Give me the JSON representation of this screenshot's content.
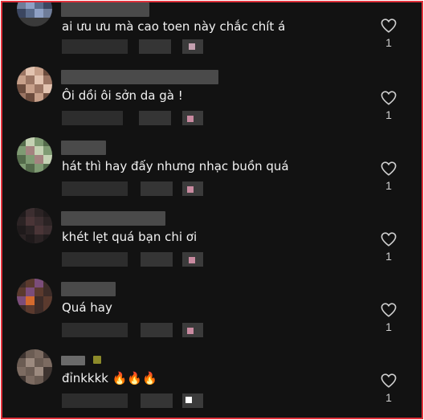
{
  "comments": [
    {
      "text": "ai ưu ưu mà cao toen này chắc chít á",
      "likes": "1",
      "avatar_colors": [
        "#5a6b8a",
        "#8ea0c4",
        "#3b4660",
        "#6f7d99"
      ]
    },
    {
      "text": "Ôi dồi ôi sởn da gà !",
      "likes": "1",
      "avatar_colors": [
        "#c7a08a",
        "#e2c3b0",
        "#6c4c3d",
        "#9b7563"
      ]
    },
    {
      "text": "hát thì hay đấy nhưng nhạc buồn quá",
      "likes": "1",
      "avatar_colors": [
        "#7f9b73",
        "#c4d2b3",
        "#a3837f",
        "#546b4b"
      ]
    },
    {
      "text": "khét lẹt quá bạn chi ơi",
      "likes": "1",
      "avatar_colors": [
        "#2b2324",
        "#3c2e30",
        "#1f1a1b",
        "#4a3537"
      ]
    },
    {
      "text": "Quá hay",
      "likes": "1",
      "avatar_colors": [
        "#5b3a2e",
        "#d46a2e",
        "#7b4d7a",
        "#3d2c28"
      ]
    },
    {
      "text": "đỉnkkkk 🔥🔥🔥",
      "likes": "1",
      "avatar_colors": [
        "#6b5c53",
        "#9c8a7f",
        "#3e3430",
        "#7c6b61"
      ]
    }
  ],
  "icons": {
    "like": "heart-outline-icon"
  }
}
